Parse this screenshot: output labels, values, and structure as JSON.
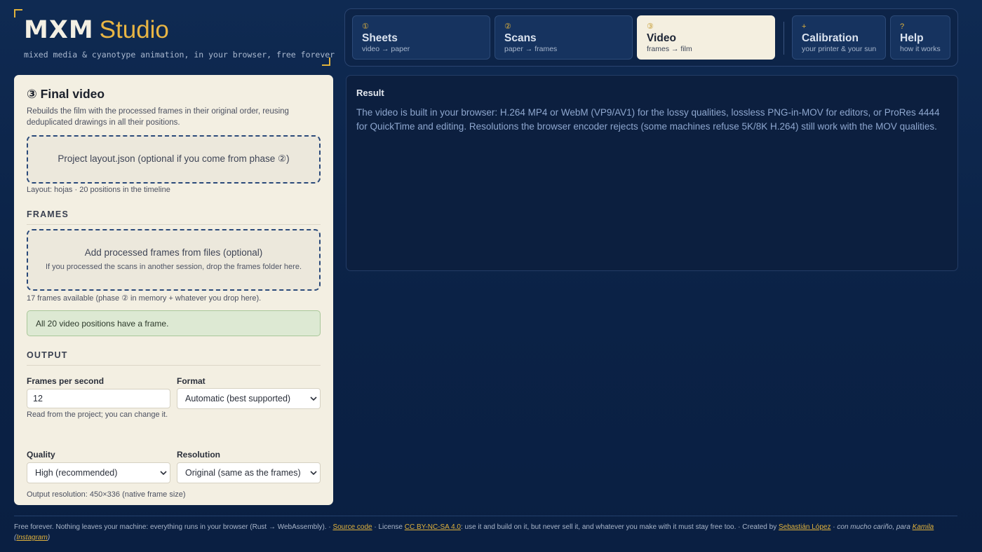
{
  "brand": {
    "name": "MXM",
    "suffix": "Studio",
    "tagline": "mixed media & cyanotype animation, in your browser, free forever"
  },
  "tabs": [
    {
      "num": "①",
      "label": "Sheets",
      "sub": "video → paper",
      "active": false
    },
    {
      "num": "②",
      "label": "Scans",
      "sub": "paper → frames",
      "active": false
    },
    {
      "num": "③",
      "label": "Video",
      "sub": "frames → film",
      "active": true
    },
    {
      "num": "+",
      "label": "Calibration",
      "sub": "your printer & your sun",
      "active": false
    },
    {
      "num": "?",
      "label": "Help",
      "sub": "how it works",
      "active": false
    }
  ],
  "panel": {
    "title": "③ Final video",
    "description": "Rebuilds the film with the processed frames in their original order, reusing deduplicated drawings in all their positions.",
    "layout_drop": "Project layout.json (optional if you come from phase ②)",
    "layout_note": "Layout: hojas · 20 positions in the timeline",
    "frames_heading": "FRAMES",
    "frames_drop_title": "Add processed frames from files (optional)",
    "frames_drop_sub": "If you processed the scans in another session, drop the frames folder here.",
    "frames_note": "17 frames available (phase ② in memory + whatever you drop here).",
    "status_ok": "All 20 video positions have a frame.",
    "output_heading": "OUTPUT",
    "fps_label": "Frames per second",
    "fps_value": "12",
    "fps_help": "Read from the project; you can change it.",
    "format_label": "Format",
    "format_value": "Automatic (best supported)",
    "quality_label": "Quality",
    "quality_value": "High (recommended)",
    "resolution_label": "Resolution",
    "resolution_value": "Original (same as the frames)",
    "output_resolution": "Output resolution: 450×336 (native frame size)"
  },
  "result": {
    "title": "Result",
    "text": "The video is built in your browser: H.264 MP4 or WebM (VP9/AV1) for the lossy qualities, lossless PNG-in-MOV for editors, or ProRes 4444 for QuickTime and editing. Resolutions the browser encoder rejects (some machines refuse 5K/8K H.264) still work with the MOV qualities."
  },
  "footer": {
    "text1": "Free forever. Nothing leaves your machine: everything runs in your browser (Rust → WebAssembly). · ",
    "source_link": "Source code",
    "text2": " · License ",
    "license_link": "CC BY-NC-SA 4.0",
    "text3": ": use it and build on it, but never sell it, and whatever you make with it must stay free too. · Created by ",
    "author_link": "Sebastián López",
    "text4": " · con mucho cariño, para ",
    "kamila_link": "Kamila",
    "text5": " (",
    "instagram_link": "Instagram",
    "text6": ")"
  },
  "colors": {
    "background": "#0b2246",
    "accent": "#e0b23c",
    "panel": "#f3efe2",
    "success_bg": "#dde9d3"
  }
}
